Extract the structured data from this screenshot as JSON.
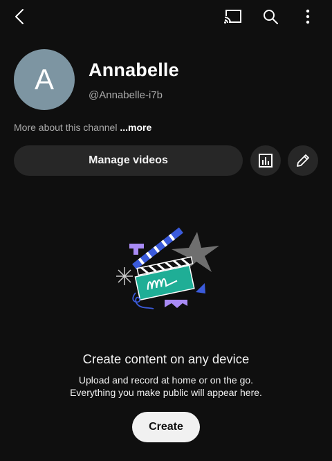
{
  "topbar": {
    "back_icon": "chevron-left-icon",
    "cast_icon": "cast-icon",
    "search_icon": "search-icon",
    "more_icon": "more-vert-icon"
  },
  "channel": {
    "avatar_letter": "A",
    "avatar_color": "#7d95a2",
    "name": "Annabelle",
    "handle": "@Annabelle-i7b",
    "about_text": "More about this channel",
    "about_more": "...more"
  },
  "actions": {
    "manage_label": "Manage videos",
    "analytics_icon": "analytics-icon",
    "edit_icon": "pencil-icon"
  },
  "empty_state": {
    "illustration": "clapperboard-illustration",
    "title": "Create content on any device",
    "desc_line1": "Upload and record at home or on the go.",
    "desc_line2": "Everything you make public will appear here.",
    "create_label": "Create"
  },
  "colors": {
    "background": "#0f0f0f",
    "surface": "#272727",
    "accent_teal": "#1fae96",
    "accent_purple": "#9f7aea",
    "accent_blue": "#3b5bdb"
  }
}
